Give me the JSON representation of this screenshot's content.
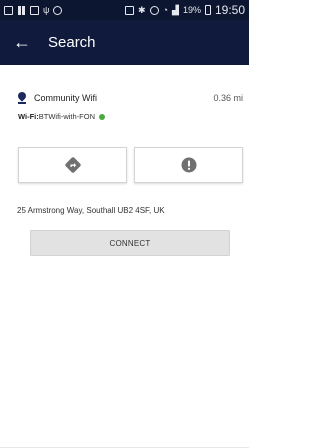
{
  "status_bar": {
    "signal_strength": "19%",
    "time": "19:50",
    "icons": [
      "notification-icon",
      "pause-icon",
      "image-icon",
      "usb-icon",
      "chat-icon",
      "sim-icon",
      "bluetooth-icon",
      "alarm-icon",
      "wifi-icon",
      "signal-icon",
      "battery-icon"
    ]
  },
  "app_bar": {
    "back_icon": "←",
    "title": "Search"
  },
  "hotspot": {
    "name": "Community Wifi",
    "distance": "0.36 mi",
    "ssid_prefix": "Wi-Fi:",
    "ssid": "BTWifi-with-FON",
    "status_color": "#4aaa3d",
    "address": "25 Armstrong Way, Southall UB2 4SF, UK"
  },
  "actions": {
    "directions_icon": "directions-icon",
    "report_icon": "report-icon",
    "connect_label": "CONNECT"
  },
  "colors": {
    "status_bar_bg": "#0d1630",
    "app_bar_bg": "#0f1a3c",
    "pin": "#1e2a5e",
    "icon_gray": "#707070"
  }
}
